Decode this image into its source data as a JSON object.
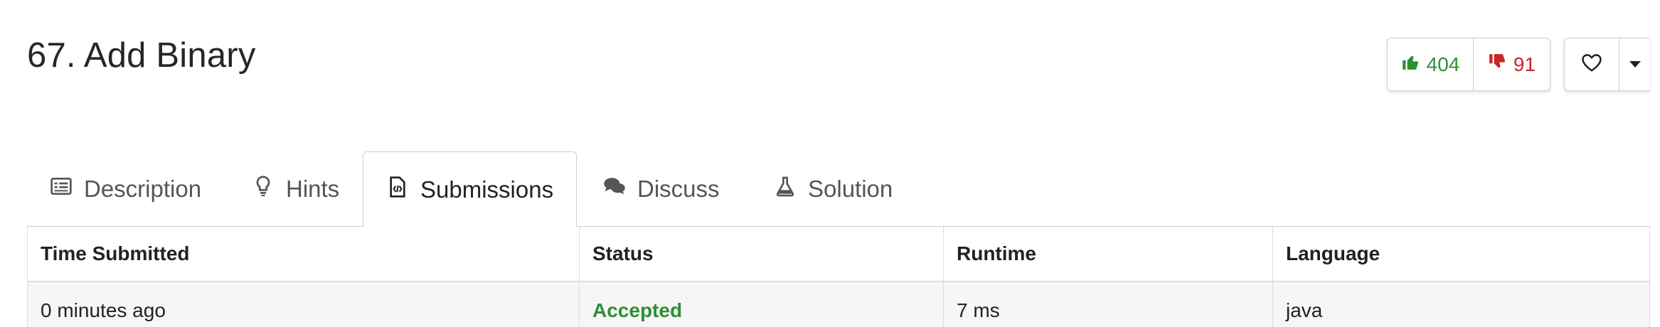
{
  "problem": {
    "title": "67. Add Binary"
  },
  "votes": {
    "likes": "404",
    "dislikes": "91"
  },
  "colors": {
    "like": "#2e8f35",
    "dislike": "#c62828",
    "accepted": "#2e8f35"
  },
  "tabs": [
    {
      "label": "Description",
      "icon": "description-icon"
    },
    {
      "label": "Hints",
      "icon": "lightbulb-icon"
    },
    {
      "label": "Submissions",
      "icon": "code-file-icon",
      "active": true
    },
    {
      "label": "Discuss",
      "icon": "comments-icon"
    },
    {
      "label": "Solution",
      "icon": "flask-icon"
    }
  ],
  "table": {
    "headers": [
      "Time Submitted",
      "Status",
      "Runtime",
      "Language"
    ],
    "rows": [
      {
        "time": "0 minutes ago",
        "status": "Accepted",
        "runtime": "7 ms",
        "language": "java"
      }
    ]
  }
}
